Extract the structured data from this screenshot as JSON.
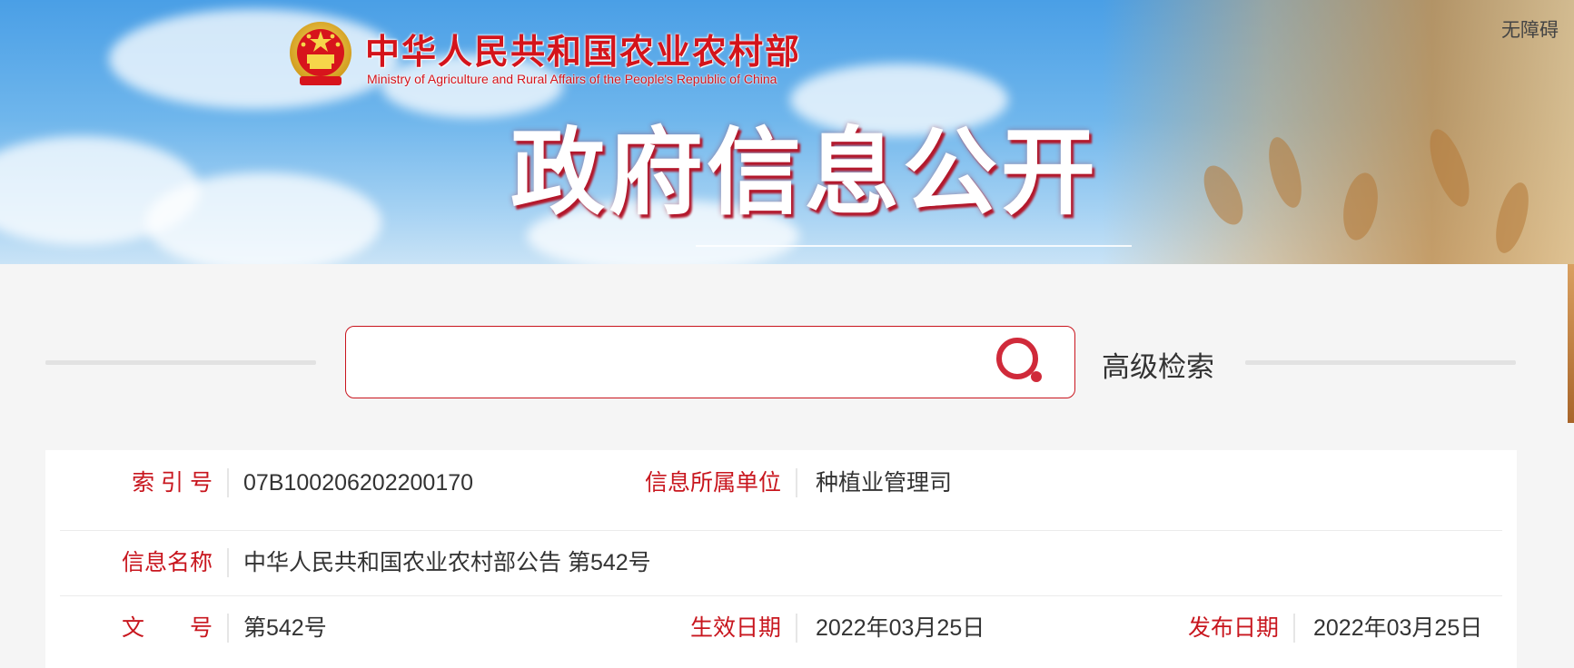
{
  "header": {
    "ministry_cn": "中华人民共和国农业农村部",
    "ministry_en": "Ministry of Agriculture and Rural Affairs of the People's Republic of China",
    "accessibility_label": "无障碍",
    "banner_title": "政府信息公开"
  },
  "search": {
    "value": "",
    "placeholder": "",
    "advanced_label": "高级检索",
    "icon": "search-icon"
  },
  "info": {
    "index_label": "索 引 号",
    "index_value": "07B100206202200170",
    "unit_label": "信息所属单位",
    "unit_value": "种植业管理司",
    "name_label": "信息名称",
    "name_value": "中华人民共和国农业农村部公告 第542号",
    "doc_no_label": "文　　号",
    "doc_no_value": "第542号",
    "effective_label": "生效日期",
    "effective_value": "2022年03月25日",
    "publish_label": "发布日期",
    "publish_value": "2022年03月25日"
  },
  "colors": {
    "brand_red": "#c8161e",
    "sky_blue": "#4a9fe6",
    "panel_bg": "#f5f5f5"
  }
}
